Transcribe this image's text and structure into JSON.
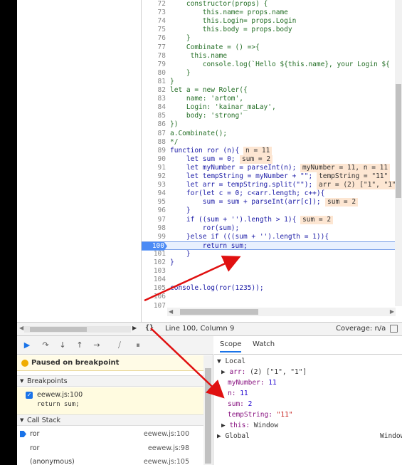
{
  "editor": {
    "lines": [
      {
        "n": "72",
        "code": "    constructor(props) {",
        "cls": "com"
      },
      {
        "n": "73",
        "code": "        this.name= props.name",
        "cls": "com"
      },
      {
        "n": "74",
        "code": "        this.Login= props.Login",
        "cls": "com"
      },
      {
        "n": "75",
        "code": "        this.body = props.body",
        "cls": "com"
      },
      {
        "n": "76",
        "code": "    }",
        "cls": "com"
      },
      {
        "n": "77",
        "code": "    Combinate = () =>{",
        "cls": "com"
      },
      {
        "n": "78",
        "code": "     this.name",
        "cls": "com"
      },
      {
        "n": "79",
        "code": "        console.log(`Hello ${this.name}, your Login ${",
        "cls": "com"
      },
      {
        "n": "80",
        "code": "    }",
        "cls": "com"
      },
      {
        "n": "81",
        "code": "}",
        "cls": "com"
      },
      {
        "n": "82",
        "code": "let a = new Roler({",
        "cls": "com"
      },
      {
        "n": "83",
        "code": "    name: 'artom',",
        "cls": "com"
      },
      {
        "n": "84",
        "code": "    Login: 'kainar_maLay',",
        "cls": "com"
      },
      {
        "n": "85",
        "code": "    body: 'strong'",
        "cls": "com"
      },
      {
        "n": "86",
        "code": "})",
        "cls": "com"
      },
      {
        "n": "87",
        "code": "a.Combinate();",
        "cls": "com"
      },
      {
        "n": "88",
        "code": "*/",
        "cls": "com"
      },
      {
        "n": "89",
        "code": "function ror (n){",
        "cls": "",
        "inline": "n = 11"
      },
      {
        "n": "90",
        "code": "    let sum = 0;",
        "cls": "",
        "inline": "sum = 2"
      },
      {
        "n": "91",
        "code": "    let myNumber = parseInt(n);",
        "cls": "",
        "inline": "myNumber = 11, n = 11"
      },
      {
        "n": "92",
        "code": "    let tempString = myNumber + \"\";",
        "cls": "",
        "inline": "tempString = \"11\""
      },
      {
        "n": "93",
        "code": "    let arr = tempString.split(\"\");",
        "cls": "",
        "inline": "arr = (2) [\"1\", \"1\"]"
      },
      {
        "n": "94",
        "code": "    for(let c = 0; c<arr.length; c++){",
        "cls": ""
      },
      {
        "n": "95",
        "code": "        sum = sum + parseInt(arr[c]);",
        "cls": "",
        "inline": "sum = 2"
      },
      {
        "n": "96",
        "code": "    }",
        "cls": ""
      },
      {
        "n": "97",
        "code": "    if ((sum + '').length > 1){",
        "cls": "",
        "inline": "sum = 2"
      },
      {
        "n": "98",
        "code": "        ror(sum);",
        "cls": ""
      },
      {
        "n": "99",
        "code": "    }else if (((sum + '').length = 1)){",
        "cls": ""
      },
      {
        "n": "100",
        "code": "        return sum;",
        "cls": "exec"
      },
      {
        "n": "101",
        "code": "    }",
        "cls": ""
      },
      {
        "n": "102",
        "code": "}",
        "cls": ""
      },
      {
        "n": "103",
        "code": "",
        "cls": ""
      },
      {
        "n": "104",
        "code": "",
        "cls": ""
      },
      {
        "n": "105",
        "code": "console.log(ror(1235));",
        "cls": ""
      },
      {
        "n": "106",
        "code": "",
        "cls": ""
      },
      {
        "n": "107",
        "code": "",
        "cls": ""
      }
    ]
  },
  "status": {
    "braces": "{}",
    "position": "Line 100, Column 9",
    "coverage": "Coverage: n/a"
  },
  "debugger": {
    "paused_label": "Paused on breakpoint",
    "breakpoints_title": "Breakpoints",
    "breakpoint_file": "eewew.js:100",
    "breakpoint_code": "return sum;",
    "callstack_title": "Call Stack",
    "frames": [
      {
        "fn": "ror",
        "loc": "eewew.js:100"
      },
      {
        "fn": "ror",
        "loc": "eewew.js:98"
      },
      {
        "fn": "(anonymous)",
        "loc": "eewew.js:105"
      }
    ]
  },
  "scope": {
    "tab_scope": "Scope",
    "tab_watch": "Watch",
    "local": "Local",
    "arr_key": "arr:",
    "arr_val": "(2) [\"1\", \"1\"]",
    "mynumber_key": "myNumber:",
    "mynumber_val": "11",
    "n_key": "n:",
    "n_val": "11",
    "sum_key": "sum:",
    "sum_val": "2",
    "temp_key": "tempString:",
    "temp_val": "\"11\"",
    "this_key": "this:",
    "this_val": "Window",
    "global": "Global",
    "global_val": "Window"
  },
  "colors": {
    "accent": "#1a73e8",
    "arrow": "#e01010",
    "exec_line": "#e8f0fe",
    "inline_value": "#fde6d2"
  }
}
